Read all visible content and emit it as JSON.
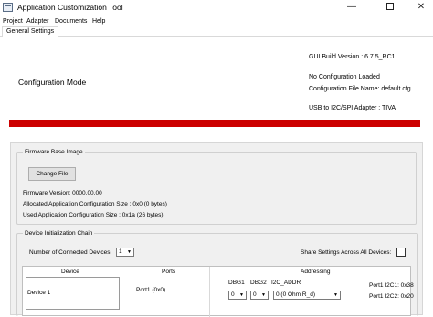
{
  "window": {
    "title": "Application Customization Tool",
    "controls": {
      "minimize": "—",
      "close": "✕"
    }
  },
  "menu": [
    "Project",
    "Adapter",
    "Documents",
    "Help"
  ],
  "tabs": [
    {
      "label": "General Settings",
      "active": true
    }
  ],
  "config_mode": "Configuration Mode",
  "info": {
    "gui_build": "GUI Build Version : 6.7.5_RC1",
    "no_config": "No Configuration Loaded",
    "config_file": "Configuration File Name: default.cfg",
    "adapter": "USB to I2C/SPI Adapter : TIVA"
  },
  "accent_color": "#cc0000",
  "firmware": {
    "group_label": "Firmware Base Image",
    "change_file_label": "Change File",
    "version": "Firmware Version:   0000.00.00",
    "allocated": "Allocated Application Configuration Size :   0x0 (0 bytes)",
    "used": "Used Application Configuration Size :   0x1a (26 bytes)"
  },
  "chain": {
    "group_label": "Device Initialization Chain",
    "num_devices_label": "Number of Connected Devices:",
    "num_devices_value": "1",
    "share_label": "Share Settings Across All Devices:",
    "share_checked": false,
    "columns": {
      "device": "Device",
      "ports": "Ports",
      "addressing": "Addressing"
    },
    "sub_headers": {
      "dbg1": "DBG1",
      "dbg2": "DBG2",
      "i2c_addr": "I2C_ADDR"
    },
    "rows": [
      {
        "device": "Device 1",
        "ports": "Port1 (0x0)",
        "dbg1": "0",
        "dbg2": "0",
        "i2c_addr": "0 (0 Ohm R_d)",
        "port1_i2c1": "Port1 I2C1: 0x38",
        "port1_i2c2": "Port1 I2C2: 0x20"
      }
    ]
  }
}
